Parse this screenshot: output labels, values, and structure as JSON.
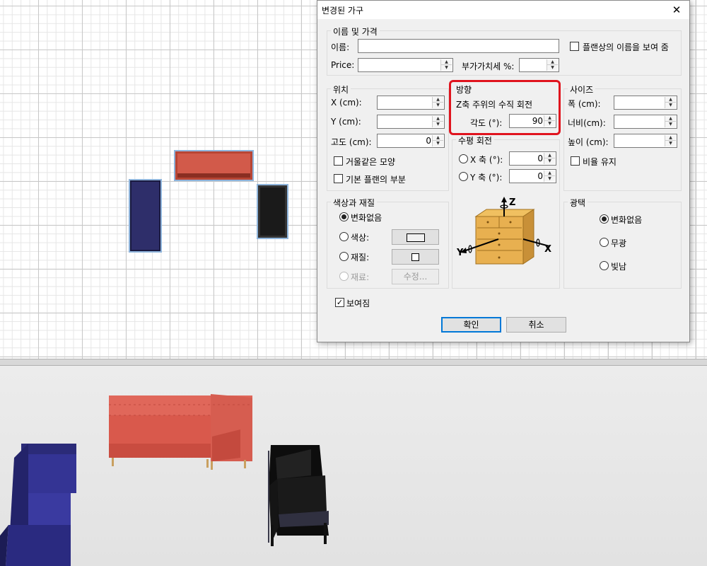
{
  "dialog": {
    "title": "변경된 가구",
    "close_glyph": "✕",
    "name_price": {
      "legend": "이름 및 가격",
      "name_label": "이름:",
      "name_value": "",
      "show_name_label": "플랜상의 이름을 보여 줌",
      "show_name_checked": false,
      "price_label": "Price:",
      "price_value": "",
      "vat_label": "부가가치세 %:",
      "vat_value": ""
    },
    "location": {
      "legend": "위치",
      "x_label": "X (cm):",
      "x_value": "",
      "y_label": "Y (cm):",
      "y_value": "",
      "elevation_label": "고도 (cm):",
      "elevation_value": "0",
      "mirror_label": "거울같은 모양",
      "mirror_checked": false,
      "base_plan_label": "기본 플랜의 부분",
      "base_plan_checked": false
    },
    "orientation": {
      "legend": "방향",
      "z_rotation_label": "Z축 주위의 수직 회전",
      "angle_label": "각도 (°):",
      "angle_value": "90",
      "horizontal_label": "수평 회전",
      "x_axis_label": "X 축 (°):",
      "x_axis_value": "0",
      "y_axis_label": "Y 축 (°):",
      "y_axis_value": "0",
      "illustration_axes": [
        "Z",
        "X",
        "Y"
      ]
    },
    "size": {
      "legend": "사이즈",
      "width_label": "폭 (cm):",
      "width_value": "",
      "depth_label": "너비(cm):",
      "depth_value": "",
      "height_label": "높이 (cm):",
      "height_value": "",
      "keep_ratio_label": "비율 유지",
      "keep_ratio_checked": false
    },
    "color_texture": {
      "legend": "색상과 재질",
      "unchanged_label": "변화없음",
      "color_label": "색상:",
      "texture_label": "재질:",
      "materials_label": "재료:",
      "modify_button": "수정...",
      "selected": "unchanged"
    },
    "shininess": {
      "legend": "광택",
      "unchanged_label": "변화없음",
      "matt_label": "무광",
      "shiny_label": "빛남",
      "selected": "unchanged"
    },
    "visible_label": "보여짐",
    "visible_checked": true,
    "ok_button": "확인",
    "cancel_button": "취소"
  },
  "colors": {
    "accent": "#0078d7",
    "highlight_box": "#e0141e",
    "sofa_red": "#d25a4a",
    "sofa_blue": "#2e2e6a",
    "sofa_black": "#1a1a1a",
    "selection_outline": "#8fb5dc"
  }
}
